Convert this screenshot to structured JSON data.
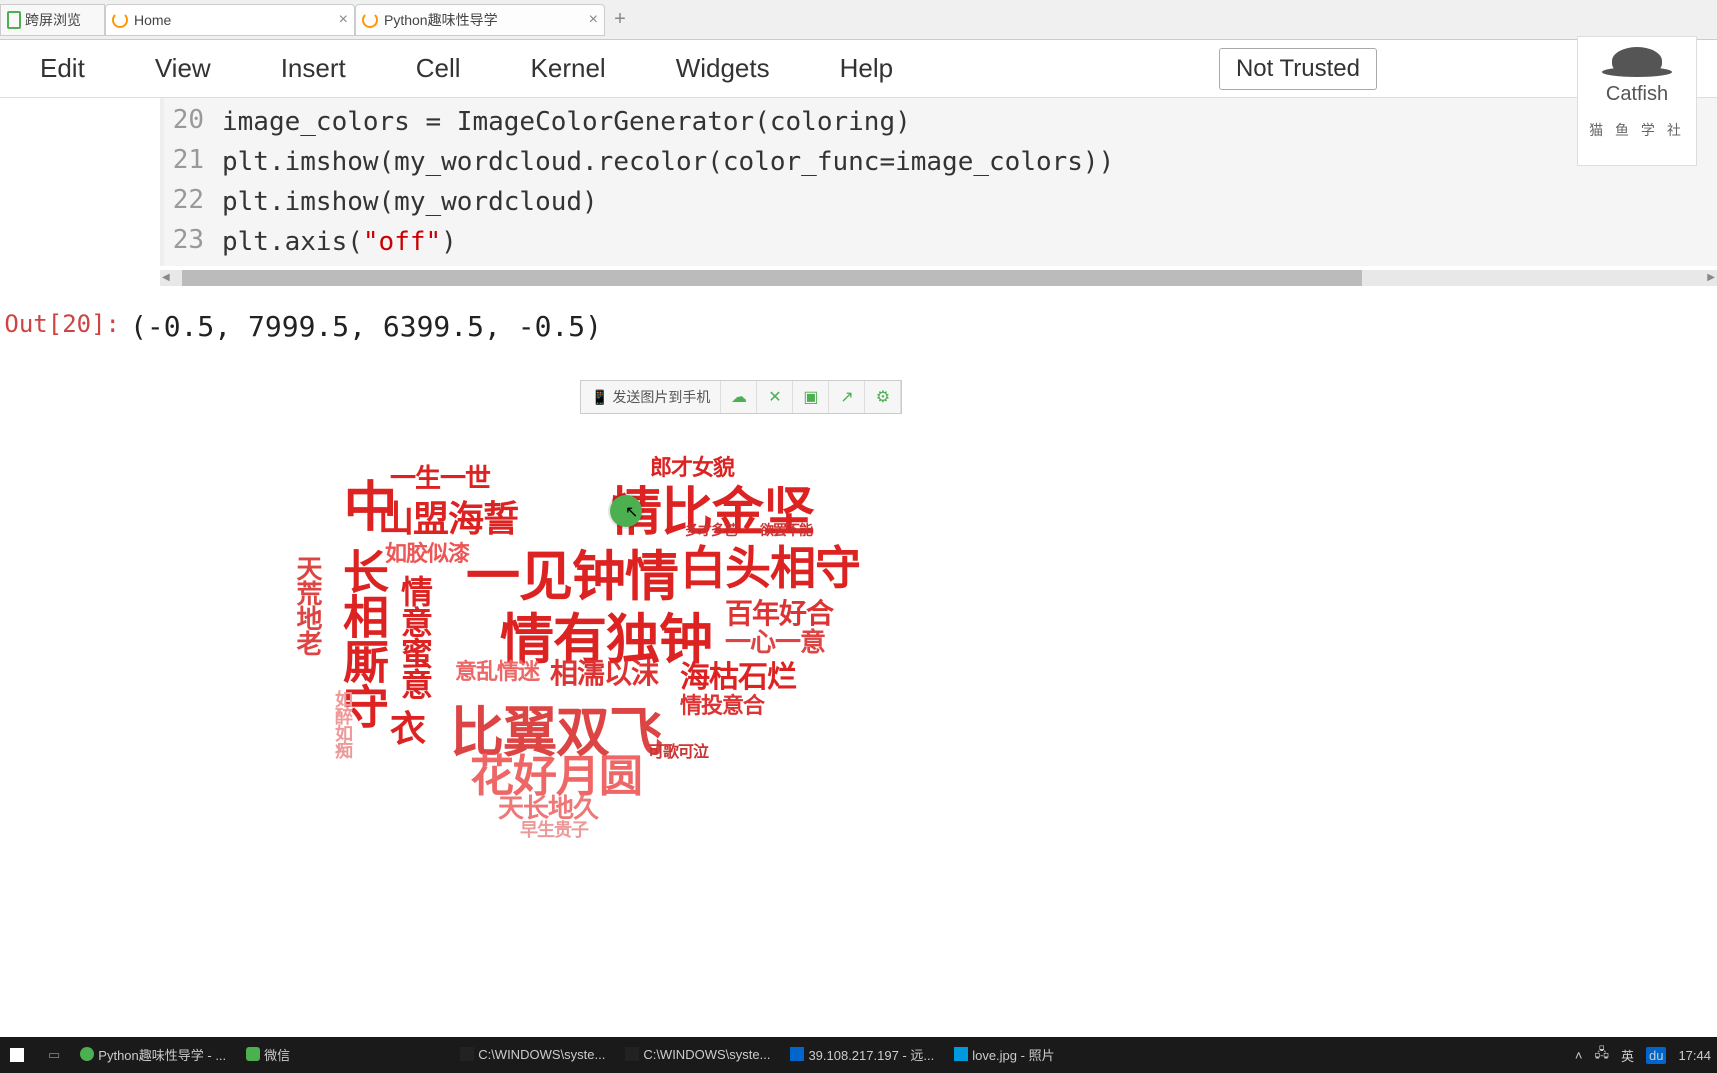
{
  "tabs": {
    "first": "跨屏浏览",
    "home": "Home",
    "active": "Python趣味性导学",
    "newtab": "+"
  },
  "menu": {
    "edit": "Edit",
    "view": "View",
    "insert": "Insert",
    "cell": "Cell",
    "kernel": "Kernel",
    "widgets": "Widgets",
    "help": "Help",
    "nottrusted": "Not Trusted"
  },
  "logo": {
    "name": "Catfish",
    "sub": "猫 鱼 学 社"
  },
  "code": {
    "lines": [
      "20",
      "21",
      "22",
      "23"
    ],
    "l20a": "image_colors = ImageColorGenerator(coloring)",
    "l21a": "plt.imshow(my_wordcloud.recolor(color_func=image_colors))",
    "l22a": "plt.imshow(my_wordcloud)",
    "l23a": "plt.axis(",
    "l23s": "\"off\"",
    "l23b": ")"
  },
  "output": {
    "label": "Out[20]:",
    "value": "(-0.5, 7999.5, 6399.5, -0.5)"
  },
  "float_toolbar": {
    "send": "发送图片到手机"
  },
  "wordcloud": {
    "w1": "情比金坚",
    "w2": "一见钟情",
    "w3": "白头相守",
    "w4": "情有独钟",
    "w5": "比翼双飞",
    "w6": "花好月圆",
    "w7": "长相厮守",
    "w8": "山盟海誓",
    "w9": "一生一世",
    "w10": "郎才女貌",
    "w11": "百年好合",
    "w12": "一心一意",
    "w13": "海枯石烂",
    "w14": "相濡以沫",
    "w15": "天长地久",
    "w16": "早生贵子",
    "w17": "情投意合",
    "w18": "如胶似漆",
    "w19": "天荒地老",
    "w20": "意乱情迷",
    "w21": "情意蜜意",
    "w22": "衣",
    "w23": "如醉如痴",
    "w24": "中",
    "w25": "可歌可泣",
    "w26": "多才多艺",
    "w27": "欲罢不能"
  },
  "taskbar": {
    "app1": "Python趣味性导学 - ...",
    "app2": "微信",
    "cmd1": "C:\\WINDOWS\\syste...",
    "cmd2": "C:\\WINDOWS\\syste...",
    "remote": "39.108.217.197 - 远...",
    "photo": "love.jpg - 照片",
    "ime": "英",
    "time": "17:44"
  }
}
